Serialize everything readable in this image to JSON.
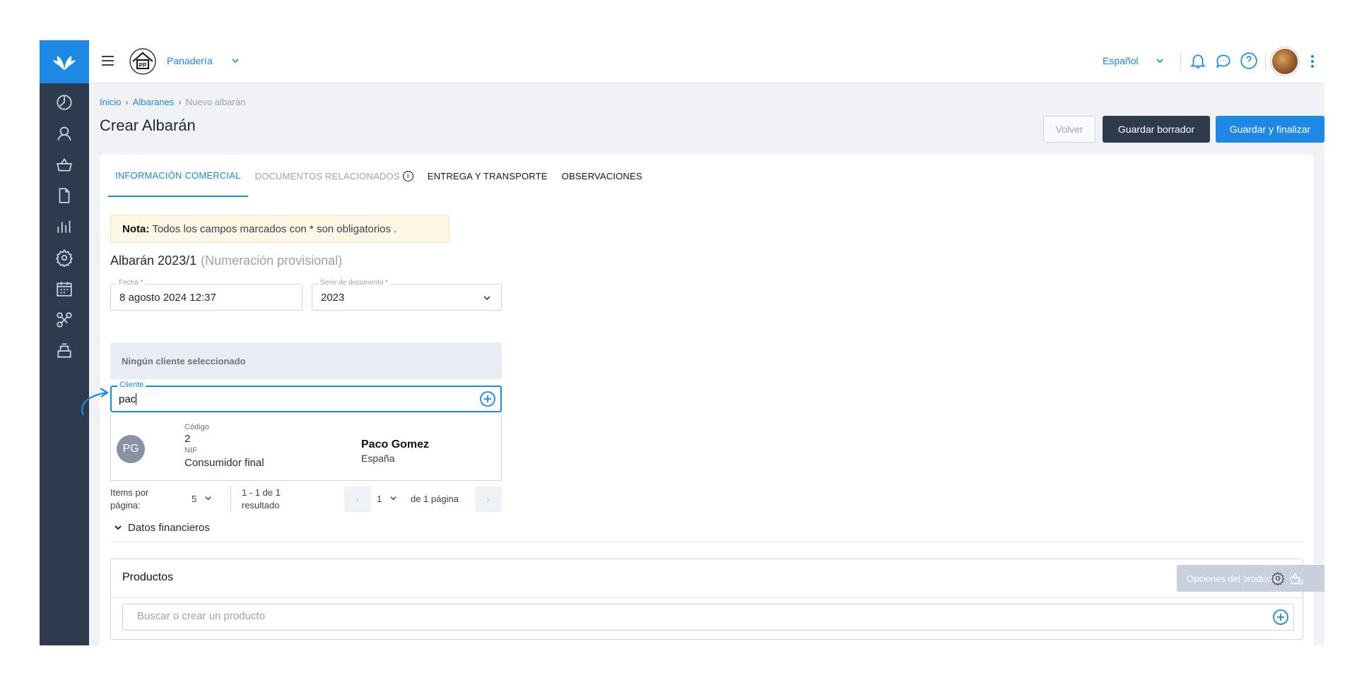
{
  "header": {
    "company": "Panadería",
    "language": "Español"
  },
  "breadcrumb": {
    "home": "Inicio",
    "section": "Albaranes",
    "current": "Nuevo albarán"
  },
  "page": {
    "title": "Crear Albarán",
    "buttons": {
      "back": "Volver",
      "save_draft": "Guardar borrador",
      "save_finish": "Guardar y finalizar"
    }
  },
  "tabs": [
    {
      "label": "INFORMACIÓN COMERCIAL",
      "active": true
    },
    {
      "label": "DOCUMENTOS RELACIONADOS"
    },
    {
      "label": "ENTREGA Y TRANSPORTE"
    },
    {
      "label": "OBSERVACIONES"
    }
  ],
  "note": {
    "label": "Nota:",
    "text": "Todos los campos marcados con * son obligatorios ."
  },
  "albaran": {
    "number": "Albarán 2023/1",
    "provisional": "(Numeración provisional)"
  },
  "fields": {
    "fecha_label": "Fecha *",
    "fecha_value": "8 agosto 2024 12:37",
    "serie_label": "Serie de documento *",
    "serie_value": "2023"
  },
  "client": {
    "empty": "Ningún cliente seleccionado",
    "label": "Cliente",
    "value": "pac"
  },
  "result": {
    "initials": "PG",
    "code_label": "Código",
    "code": "2",
    "nif_label": "NIF",
    "type": "Consumidor final",
    "name": "Paco Gomez",
    "country": "España"
  },
  "pager": {
    "items_label": "Items por\npágina:",
    "items_value": "5",
    "range": "1 - 1 de 1\nresultado",
    "page": "1",
    "of_pages": "de 1 página"
  },
  "financial": {
    "label": "Datos financieros"
  },
  "products": {
    "title": "Productos",
    "options": "Opciones del producto",
    "search_placeholder": "Buscar o crear un producto"
  },
  "colors": {
    "primary": "#1e88e5",
    "sidebar": "#2e3a4d",
    "note_bg": "#fff7e6"
  }
}
